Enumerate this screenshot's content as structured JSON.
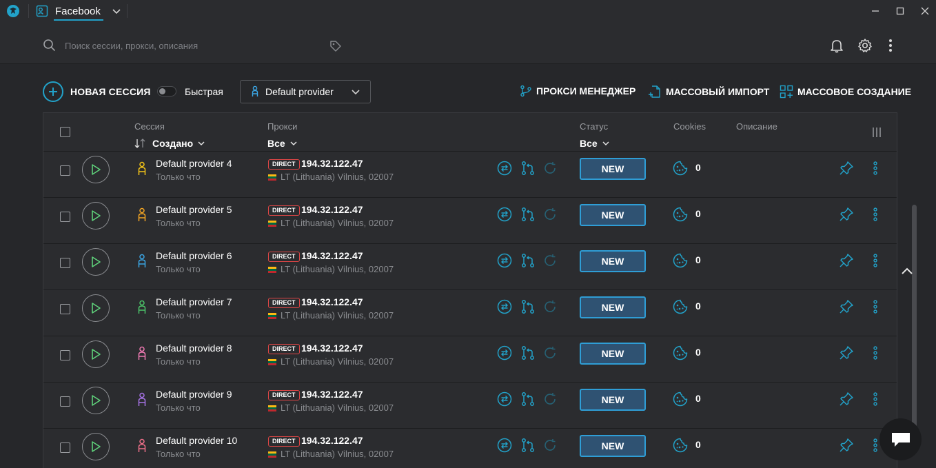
{
  "window": {
    "profile_label": "Facebook"
  },
  "search": {
    "placeholder": "Поиск сессии, прокси, описания"
  },
  "toolbar": {
    "new_session": "НОВАЯ СЕССИЯ",
    "fast_label": "Быстрая",
    "fast_enabled": false,
    "provider": "Default provider",
    "proxy_manager": "ПРОКСИ МЕНЕДЖЕР",
    "mass_import": "МАССОВЫЙ ИМПОРТ",
    "mass_create": "МАССОВОЕ СОЗДАНИЕ"
  },
  "table": {
    "headers": {
      "session": "Сессия",
      "session_sort": "Создано",
      "proxy": "Прокси",
      "proxy_filter": "Все",
      "status": "Статус",
      "status_filter": "Все",
      "cookies": "Cookies",
      "description": "Описание"
    },
    "rows": [
      {
        "name": "Default provider 4",
        "sub": "Только что",
        "proxy_type": "DIRECT",
        "ip": "194.32.122.47",
        "location": "LT (Lithuania) Vilnius, 02007",
        "status": "NEW",
        "cookies": "0",
        "icon_color": "#f5c518"
      },
      {
        "name": "Default provider 5",
        "sub": "Только что",
        "proxy_type": "DIRECT",
        "ip": "194.32.122.47",
        "location": "LT (Lithuania) Vilnius, 02007",
        "status": "NEW",
        "cookies": "0",
        "icon_color": "#f5a623"
      },
      {
        "name": "Default provider 6",
        "sub": "Только что",
        "proxy_type": "DIRECT",
        "ip": "194.32.122.47",
        "location": "LT (Lithuania) Vilnius, 02007",
        "status": "NEW",
        "cookies": "0",
        "icon_color": "#3ba7e6"
      },
      {
        "name": "Default provider 7",
        "sub": "Только что",
        "proxy_type": "DIRECT",
        "ip": "194.32.122.47",
        "location": "LT (Lithuania) Vilnius, 02007",
        "status": "NEW",
        "cookies": "0",
        "icon_color": "#4cc46a"
      },
      {
        "name": "Default provider 8",
        "sub": "Только что",
        "proxy_type": "DIRECT",
        "ip": "194.32.122.47",
        "location": "LT (Lithuania) Vilnius, 02007",
        "status": "NEW",
        "cookies": "0",
        "icon_color": "#f07ab3"
      },
      {
        "name": "Default provider 9",
        "sub": "Только что",
        "proxy_type": "DIRECT",
        "ip": "194.32.122.47",
        "location": "LT (Lithuania) Vilnius, 02007",
        "status": "NEW",
        "cookies": "0",
        "icon_color": "#a874e8"
      },
      {
        "name": "Default provider 10",
        "sub": "Только что",
        "proxy_type": "DIRECT",
        "ip": "194.32.122.47",
        "location": "LT (Lithuania) Vilnius, 02007",
        "status": "NEW",
        "cookies": "0",
        "icon_color": "#f0708a"
      }
    ]
  },
  "colors": {
    "accent": "#22a2c9",
    "status_fill": "#2f5272",
    "status_border": "#2f9ed6",
    "direct_border": "#e04646"
  },
  "icons": {
    "app": "app-logo-icon",
    "search": "search-icon",
    "tag": "tag-icon",
    "bell": "bell-icon",
    "gear": "gear-icon",
    "kebab": "kebab-icon",
    "play": "play-icon",
    "person": "person-icon",
    "swap": "swap-icon",
    "branch": "branch-icon",
    "refresh": "refresh-icon",
    "cookie": "cookie-icon",
    "pin": "pin-icon",
    "chat": "chat-icon"
  }
}
